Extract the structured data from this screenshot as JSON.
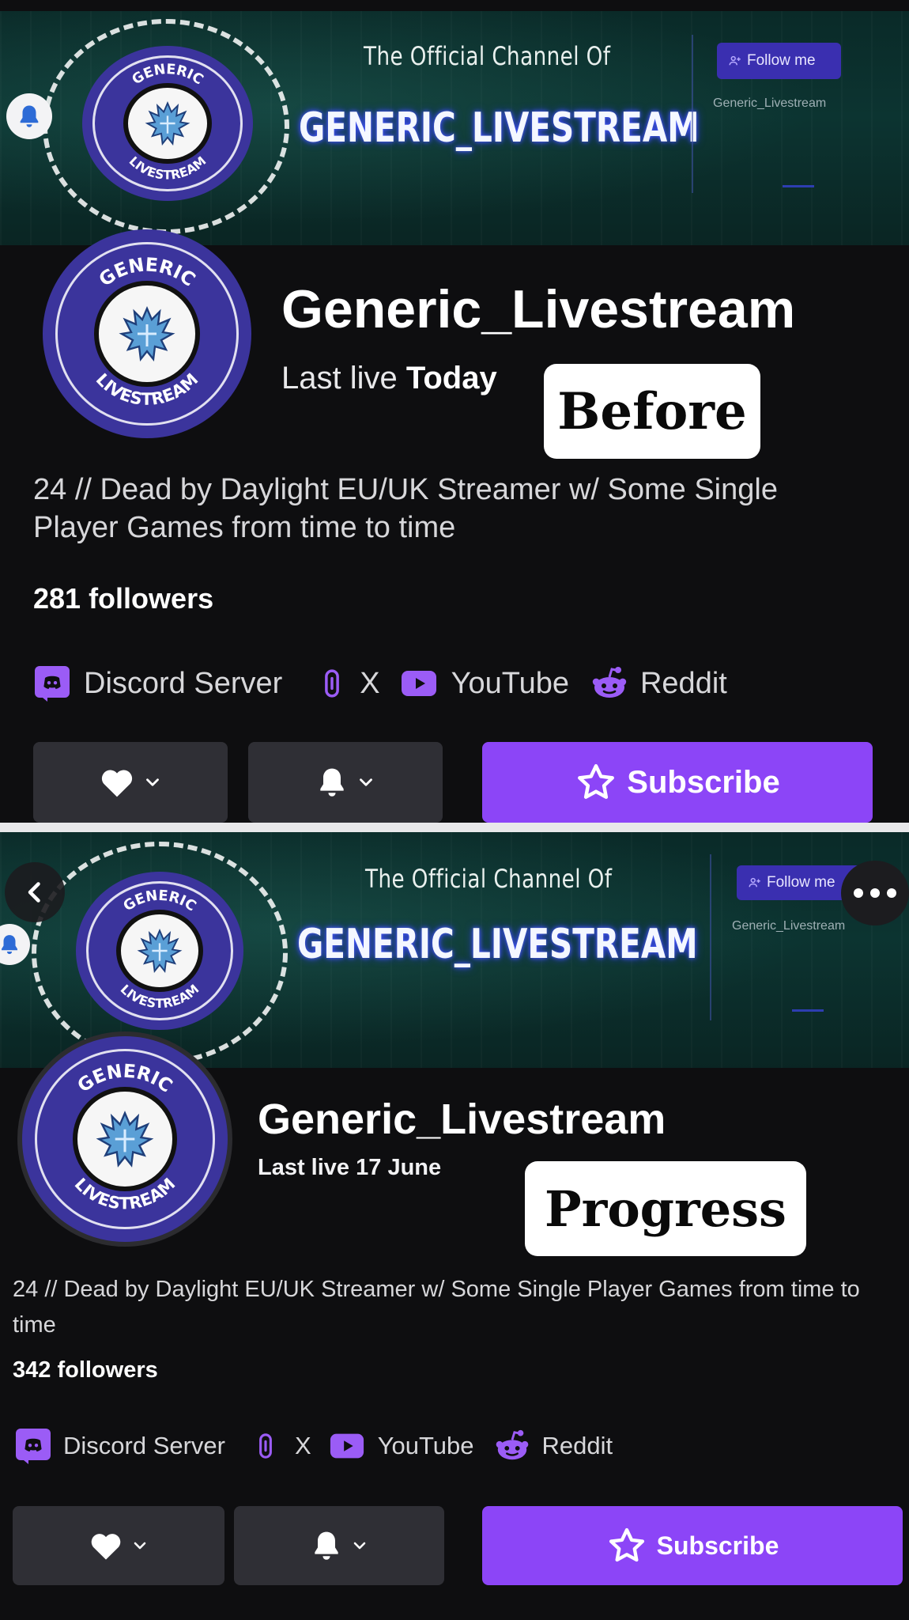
{
  "before": {
    "banner": {
      "subtitle": "The Official Channel Of",
      "title": "GENERIC_LIVESTREAM",
      "follow_label": "Follow me",
      "handle": "Generic_Livestream"
    },
    "logo_text_top": "GENERIC",
    "logo_text_bottom": "LIVESTREAM",
    "channel_name": "Generic_Livestream",
    "last_live_prefix": "Last live",
    "last_live_value": "Today",
    "tag": "Before",
    "bio": "24 // Dead by Daylight EU/UK Streamer w/ Some Single Player Games from time to time",
    "followers": "281 followers",
    "links": {
      "discord": "Discord Server",
      "x": "X",
      "youtube": "YouTube",
      "reddit": "Reddit"
    },
    "subscribe": "Subscribe"
  },
  "progress": {
    "banner": {
      "subtitle": "The Official Channel Of",
      "title": "GENERIC_LIVESTREAM",
      "follow_label": "Follow me",
      "handle": "Generic_Livestream"
    },
    "logo_text_top": "GENERIC",
    "logo_text_bottom": "LIVESTREAM",
    "channel_name": "Generic_Livestream",
    "last_live_prefix": "Last live",
    "last_live_value": "17 June",
    "tag": "Progress",
    "bio": "24 // Dead by Daylight EU/UK Streamer w/ Some Single Player Games from time to time",
    "followers": "342 followers",
    "links": {
      "discord": "Discord Server",
      "x": "X",
      "youtube": "YouTube",
      "reddit": "Reddit"
    },
    "subscribe": "Subscribe"
  },
  "colors": {
    "accent": "#8c45f7",
    "discord": "#9b5cf6",
    "background": "#0e0e10",
    "logo": "#3b349c"
  },
  "icons": [
    "bell-icon",
    "heart-icon",
    "chevron-down-icon",
    "star-icon",
    "discord-icon",
    "link-icon",
    "youtube-icon",
    "reddit-icon",
    "back-chevron-icon",
    "more-icon",
    "follow-user-icon"
  ]
}
